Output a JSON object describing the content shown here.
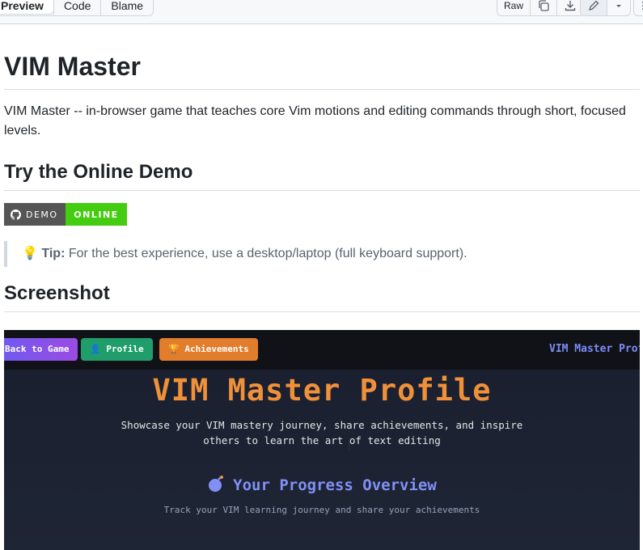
{
  "toolbar": {
    "tabs": [
      "Preview",
      "Code",
      "Blame"
    ],
    "active_tab": "Preview",
    "raw_label": "Raw"
  },
  "readme": {
    "title": "VIM Master",
    "description": "VIM Master -- in-browser game that teaches core Vim motions and editing commands through short, focused levels.",
    "demo_heading": "Try the Online Demo",
    "badge_left": "DEMO",
    "badge_right": "ONLINE",
    "tip_icon": "💡",
    "tip_label": "Tip:",
    "tip_text": "For the best experience, use a desktop/laptop (full keyboard support).",
    "screenshot_heading": "Screenshot"
  },
  "screenshot": {
    "buttons": [
      "Back to Game",
      "👤 Profile",
      "🏆 Achievements"
    ],
    "brand": "VIM Master Prof",
    "title": "VIM Master Profile",
    "subtitle": "Showcase your VIM mastery journey, share achievements, and inspire others to learn the art of text editing",
    "section_title": "Your Progress Overview",
    "section_sub": "Track your VIM learning journey and share your achievements"
  },
  "colors": {
    "badge_green": "#44cc11",
    "title_orange": "#f0913a",
    "accent_purple": "#8190f5"
  }
}
